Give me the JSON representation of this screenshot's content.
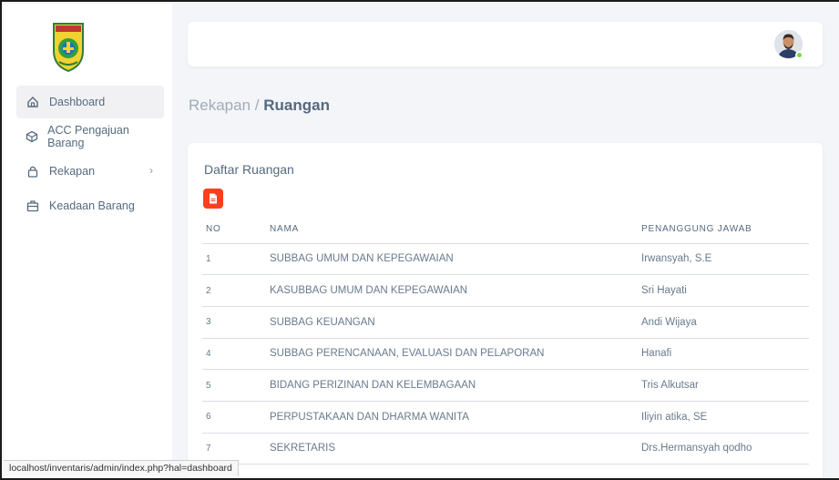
{
  "sidebar": {
    "items": [
      {
        "label": "Dashboard",
        "icon": "home-icon",
        "active": true
      },
      {
        "label": "ACC Pengajuan Barang",
        "icon": "box-icon",
        "active": false
      },
      {
        "label": "Rekapan",
        "icon": "lock-icon",
        "active": false,
        "has_submenu": true
      },
      {
        "label": "Keadaan Barang",
        "icon": "briefcase-icon",
        "active": false
      }
    ],
    "submenu_chevron": "›"
  },
  "status_url": "localhost/inventaris/admin/index.php?hal=dashboard",
  "breadcrumb": {
    "parent": "Rekapan",
    "separator": "/",
    "current": "Ruangan"
  },
  "card": {
    "title": "Daftar Ruangan",
    "pdf_button_icon": "file-pdf-icon"
  },
  "table": {
    "headers": {
      "no": "NO",
      "nama": "NAMA",
      "pj": "PENANGGUNG JAWAB"
    },
    "rows": [
      {
        "no": "1",
        "nama": "SUBBAG UMUM DAN KEPEGAWAIAN",
        "pj": "Irwansyah, S.E"
      },
      {
        "no": "2",
        "nama": "KASUBBAG UMUM DAN KEPEGAWAIAN",
        "pj": "Sri Hayati"
      },
      {
        "no": "3",
        "nama": "SUBBAG KEUANGAN",
        "pj": "Andi Wijaya"
      },
      {
        "no": "4",
        "nama": "SUBBAG PERENCANAAN, EVALUASI DAN PELAPORAN",
        "pj": "Hanafi"
      },
      {
        "no": "5",
        "nama": "BIDANG PERIZINAN DAN KELEMBAGAAN",
        "pj": "Tris Alkutsar"
      },
      {
        "no": "6",
        "nama": "PERPUSTAKAAN DAN DHARMA WANITA",
        "pj": "Iliyin atika, SE"
      },
      {
        "no": "7",
        "nama": "SEKRETARIS",
        "pj": "Drs.Hermansyah qodho"
      }
    ]
  },
  "colors": {
    "accent_red": "#ff3e1d",
    "online_green": "#71dd37",
    "text": "#566a7f",
    "background": "#f4f5f9"
  }
}
